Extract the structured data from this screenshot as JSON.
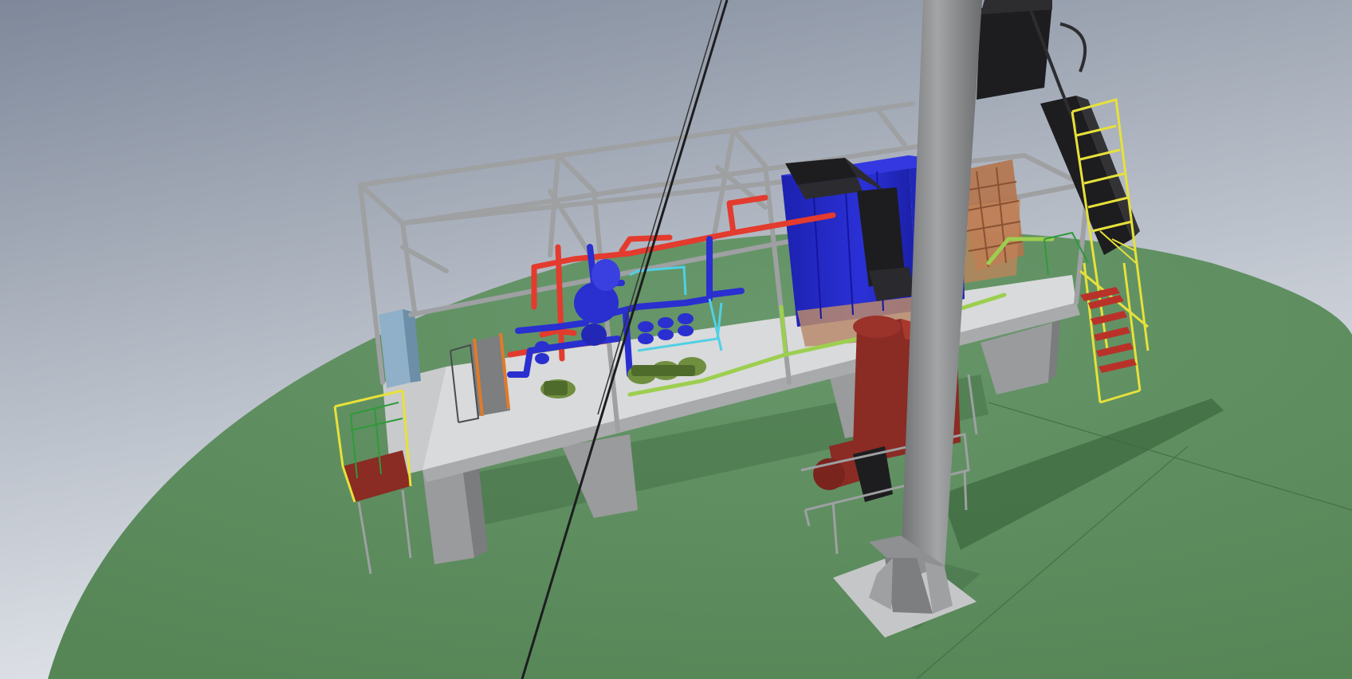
{
  "viewport": {
    "background_top": "#7e889a",
    "background_mid": "#aeb5c0",
    "background_bottom": "#e6e9ee",
    "ground_color": "#5c8b5c",
    "steel_color": "#9ea0a2",
    "steel_dark": "#7c7e80",
    "deck_color": "#d9dadb",
    "boiler_color": "#2228c4",
    "duct_color": "#1d1d1f",
    "hot_pipe_color": "#e33b2e",
    "cold_pipe_color": "#2a2fd0",
    "cyan_pipe_color": "#4fd0e6",
    "green_pipe_color": "#9ccf4f",
    "ladder_color": "#e7e13a",
    "fan_color": "#8a2b24",
    "hopper_color": "#b5744c",
    "panel_color": "#8fb0c8"
  },
  "scene": {
    "objects": [
      "ground-disc",
      "boiler-frame",
      "steel-deck",
      "concrete-piers",
      "boiler-body",
      "flue-duct",
      "chimney",
      "chimney-base",
      "guy-wire",
      "plate-heat-exchanger",
      "circulation-pumps",
      "hot-water-pipes",
      "return-pipes",
      "fuel-hopper",
      "inclined-conveyor",
      "smoke-exhauster-fan",
      "access-stair",
      "service-platform",
      "control-cabinet"
    ]
  }
}
